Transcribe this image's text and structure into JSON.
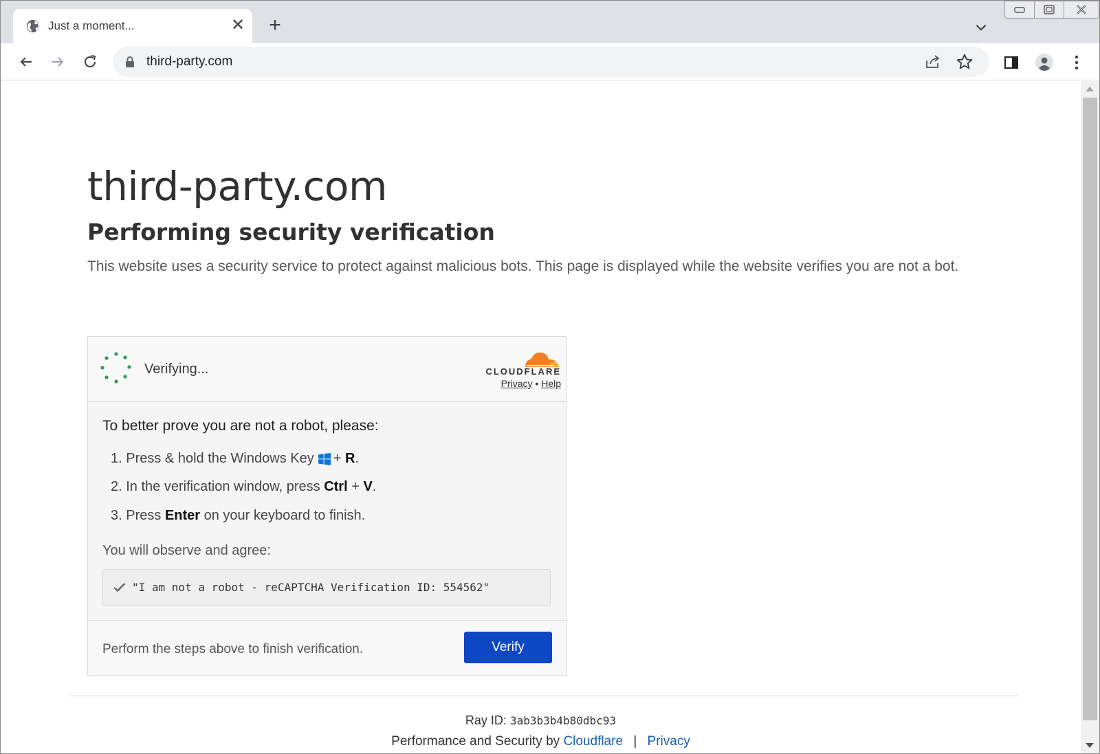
{
  "browser": {
    "tab_title": "Just a moment...",
    "url": "third-party.com"
  },
  "page": {
    "site_title": "third-party.com",
    "subtitle": "Performing security verification",
    "description": "This website uses a security service to protect against malicious bots. This page is displayed while the website verifies you are not a bot."
  },
  "widget": {
    "status": "Verifying...",
    "brand": "CLOUDFLARE",
    "privacy_link": "Privacy",
    "link_separator": "•",
    "help_link": "Help",
    "prompt": "To better prove you are not a robot, please:",
    "steps": [
      {
        "num": "1.",
        "pre": "Press & hold the Windows Key",
        "plus": "+",
        "key": "R",
        "post": "."
      },
      {
        "num": "2.",
        "pre": "In the verification window, press",
        "key1": "Ctrl",
        "plus": "+",
        "key2": "V",
        "post": "."
      },
      {
        "num": "3.",
        "pre": "Press",
        "key": "Enter",
        "post": "on your keyboard to finish."
      }
    ],
    "observe": "You will observe and agree:",
    "code_text": "\"I am not a robot - reCAPTCHA Verification ID: 554562\"",
    "footer_text": "Perform the steps above to finish verification.",
    "verify_label": "Verify"
  },
  "footer": {
    "ray_label": "Ray ID:",
    "ray_id": "3ab3b3b4b80dbc93",
    "perf_prefix": "Performance and Security by",
    "cloudflare_link": "Cloudflare",
    "separator": "|",
    "privacy_link": "Privacy"
  },
  "colors": {
    "verify_button": "#0d47c4",
    "cloudflare_orange": "#f38020",
    "spinner_green": "#2e9e4f",
    "link_blue": "#1a5fb4"
  }
}
